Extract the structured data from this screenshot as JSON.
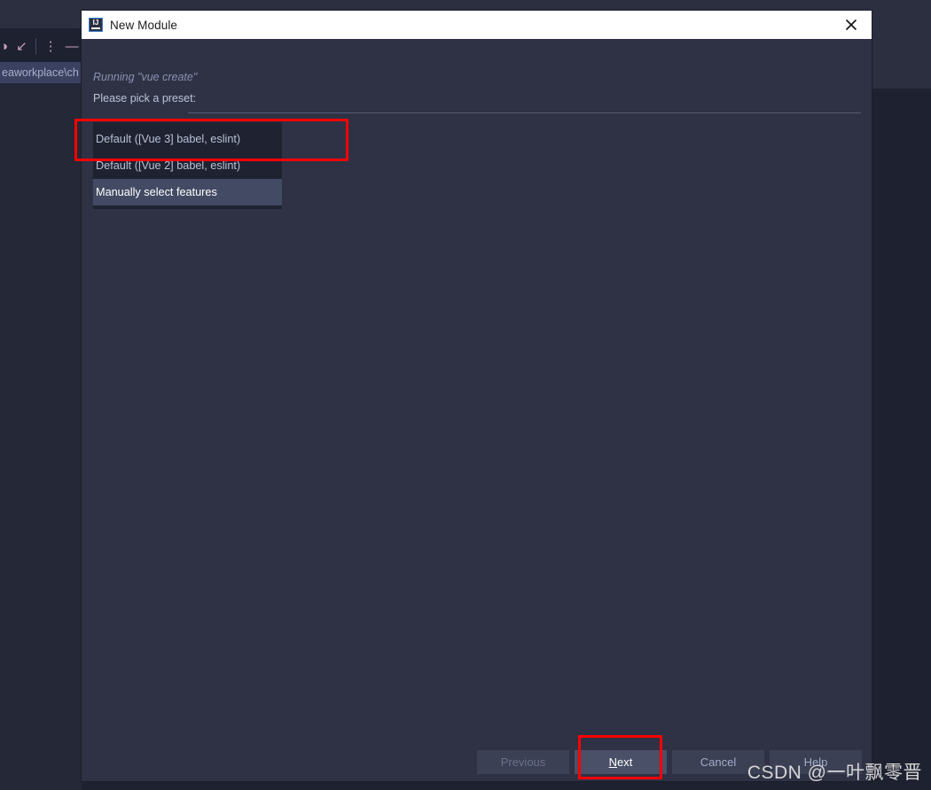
{
  "ide": {
    "breadcrumb": "eaworkplace\\ch",
    "toolbar_icons": [
      {
        "name": "circle-icon",
        "glyph": "◑"
      },
      {
        "name": "collapse-arrows-icon",
        "glyph": "↙"
      },
      {
        "name": "more-vertical-icon",
        "glyph": "⋮"
      },
      {
        "name": "minimize-icon",
        "glyph": "—"
      }
    ]
  },
  "dialog": {
    "title": "New Module",
    "app_icon_label": "IJ",
    "close_icon": "close-icon",
    "running_label": "Running \"vue create\"",
    "prompt_label": "Please pick a preset:",
    "presets": [
      {
        "label": "Default ([Vue 3] babel, eslint)",
        "selected": false
      },
      {
        "label": "Default ([Vue 2] babel, eslint)",
        "selected": false
      },
      {
        "label": "Manually select features",
        "selected": true
      }
    ],
    "buttons": [
      {
        "name": "previous-button",
        "label": "Previous",
        "state": "disabled",
        "mnemonic": ""
      },
      {
        "name": "next-button",
        "label": "Next",
        "state": "default",
        "mnemonic": "N"
      },
      {
        "name": "cancel-button",
        "label": "Cancel",
        "state": "normal",
        "mnemonic": ""
      },
      {
        "name": "help-button",
        "label": "Help",
        "state": "normal",
        "mnemonic": ""
      }
    ]
  },
  "annotations": {
    "color": "#fe0000",
    "targets": [
      "preset-vue2",
      "next-button"
    ]
  },
  "watermark": "CSDN @一叶飘零晋"
}
